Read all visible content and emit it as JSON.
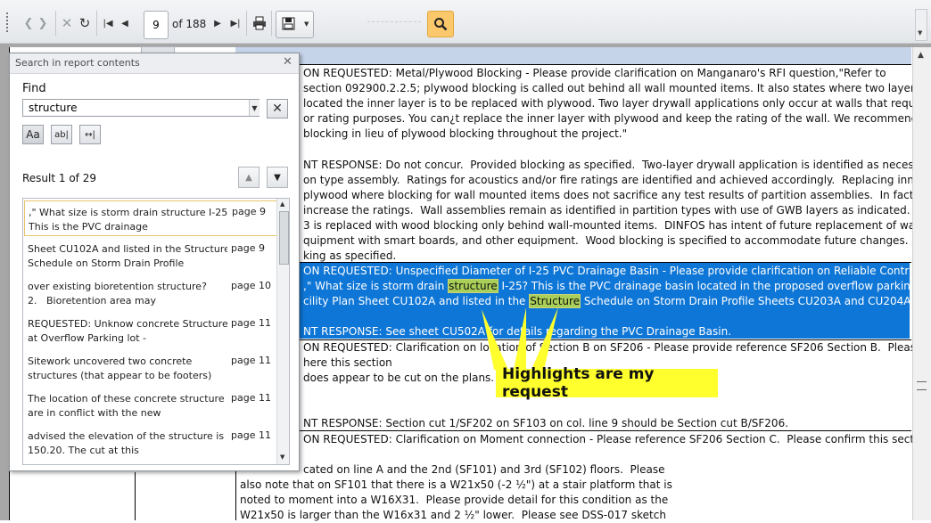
{
  "toolbar": {
    "page_number": "9",
    "of_pages": "of 188",
    "icons": [
      "back-icon",
      "forward-icon",
      "stop-icon",
      "refresh-icon",
      "first-page-icon",
      "prev-page-icon",
      "next-page-icon",
      "last-page-icon",
      "print-icon",
      "save-icon",
      "search-icon"
    ]
  },
  "report": {
    "lines": [
      {
        "text": "ON REQUESTED: Metal/Plywood Blocking - Please provide clarification on Manganaro's RFI question,\"Refer to"
      },
      {
        "text": "section 092900.2.2.5; plywood blocking is called out behind all wall mounted items. It also states where two layers of"
      },
      {
        "text": "located the inner layer is to be replaced with plywood. Two layer drywall applications only occur at walls that require"
      },
      {
        "text": "or rating purposes. You can¿t replace the inner layer with plywood and keep the rating of the wall. We recommend"
      },
      {
        "text": "blocking in lieu of plywood blocking throughout the project.\""
      },
      {
        "text": "NT RESPONSE: Do not concur.  Provided blocking as specified.  Two-layer drywall application is identified as necessary in"
      },
      {
        "text": "on type assembly.  Ratings for acoustics and/or fire ratings are identified and achieved accordingly.  Replacing inner layer"
      },
      {
        "text": "plywood where blocking for wall mounted items does not sacrifice any test results of partition assemblies.  In fact the"
      },
      {
        "text": "increase the ratings.  Wall assemblies remain as identified in partition types with use of GWB layers as indicated.  Inner"
      },
      {
        "text": "3 is replaced with wood blocking only behind wall-mounted items.  DINFOS has intent of future replacement of wall-"
      },
      {
        "text": "quipment with smart boards, and other equipment.  Wood blocking is specified to accommodate future changes."
      },
      {
        "text": "king as specified."
      }
    ],
    "selected": {
      "l1": "ON REQUESTED: Unspecified Diameter of I-25 PVC Drainage Basin - Please provide clarification on Reliable Contracting's",
      "l2a": ",\" What size is storm drain ",
      "l2hl": "structure",
      "l2b": " I-25? This is the PVC drainage basin located in the proposed overflow parking lot as",
      "l3a": "cility Plan Sheet CU102A and listed in the ",
      "l3hl": "Structure",
      "l3b": " Schedule on Storm Drain Profile Sheets CU203A and CU204A.\"",
      "l4": "NT RESPONSE: See sheet CU502A for details regarding the PVC Drainage Basin."
    },
    "block3": [
      "ON REQUESTED: Clarification on location of Section B on SF206 - Please provide reference SF206 Section B.  Please provide",
      "here this section",
      "does appear to be cut on the plans.",
      "NT RESPONSE: Section cut 1/SF202 on SF103 on col. line 9 should be Section cut B/SF206."
    ],
    "block4": [
      "ON REQUESTED: Clarification on Moment connection - Please reference SF206 Section C.  Please confirm this section",
      "cated on line A and the 2nd (SF101) and 3rd (SF102) floors.  Please",
      "also note that on SF101 that there is a W21x50 (-2 ½\") at a stair platform that is",
      "noted to moment into a W16X31.  Please provide detail for this condition as the",
      "W21x50 is larger than the W16x31 and 2 ½\" lower.  Please see DSS-017 sketch"
    ]
  },
  "callout": {
    "text": "Highlights are my request",
    "color": "#ffff2e"
  },
  "search_panel": {
    "title": "Search in report contents",
    "find_label": "Find",
    "find_value": "structure",
    "options": [
      "Aa",
      "ab|",
      "↔|"
    ],
    "result_label": "Result 1 of 29",
    "results": [
      {
        "text": ",\" What size is storm drain structure I-25?\nThis is the PVC drainage",
        "page": "page 9"
      },
      {
        "text": "Sheet CU102A and listed in the Structure\nSchedule on Storm Drain Profile",
        "page": "page 9"
      },
      {
        "text": "over existing bioretention structure?\n2.   Bioretention area may",
        "page": "page 10"
      },
      {
        "text": "REQUESTED: Unknow concrete Structures\nat Overflow Parking lot -",
        "page": "page 11"
      },
      {
        "text": "Sitework uncovered two concrete\nstructures (that appear to be footers)",
        "page": "page 11"
      },
      {
        "text": "The location of these concrete structure\nare in conflict with the new",
        "page": "page 11"
      },
      {
        "text": "advised the elevation of the structure is\n150.20. The cut at this",
        "page": "page 11"
      }
    ]
  },
  "colors": {
    "selected_row": "#0e76d6",
    "highlight": "#a9cf58",
    "accent_search": "#fbc96b"
  }
}
